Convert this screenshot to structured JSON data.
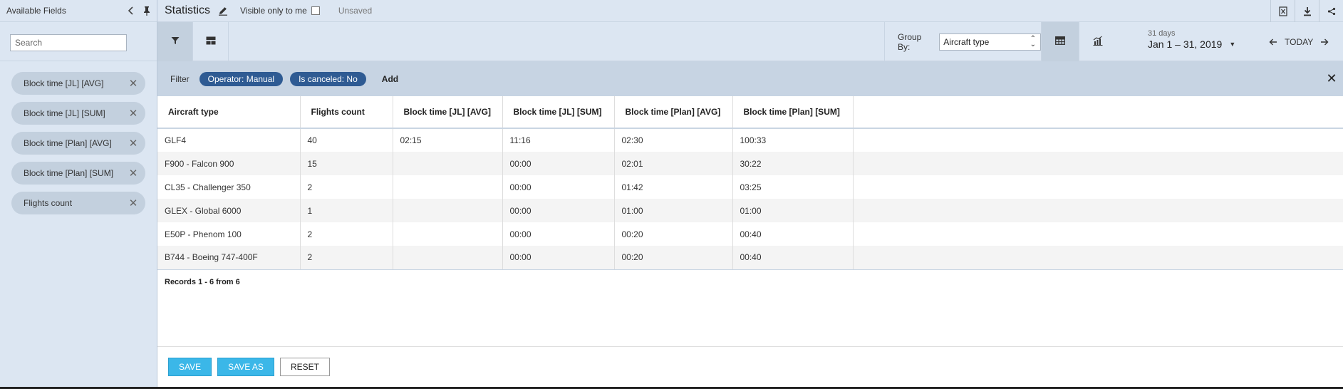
{
  "sidebar": {
    "title": "Available Fields",
    "search_placeholder": "Search",
    "chips": [
      {
        "label": "Block time [JL] [AVG]"
      },
      {
        "label": "Block time [JL] [SUM]"
      },
      {
        "label": "Block time [Plan] [AVG]"
      },
      {
        "label": "Block time [Plan] [SUM]"
      },
      {
        "label": "Flights count"
      }
    ]
  },
  "topbar": {
    "title": "Statistics",
    "visible_label": "Visible only to me",
    "status": "Unsaved"
  },
  "toolbar": {
    "groupby_label": "Group By:",
    "groupby_value": "Aircraft type",
    "range_days": "31 days",
    "range_dates": "Jan 1 – 31, 2019",
    "today_label": "TODAY"
  },
  "filter": {
    "label": "Filter",
    "pills": [
      "Operator: Manual",
      "Is canceled: No"
    ],
    "add_label": "Add"
  },
  "table": {
    "columns": [
      "Aircraft type",
      "Flights count",
      "Block time [JL] [AVG]",
      "Block time [JL] [SUM]",
      "Block time [Plan] [AVG]",
      "Block time [Plan] [SUM]"
    ],
    "rows": [
      [
        "GLF4",
        "40",
        "02:15",
        "11:16",
        "02:30",
        "100:33"
      ],
      [
        "F900 - Falcon 900",
        "15",
        "",
        "00:00",
        "02:01",
        "30:22"
      ],
      [
        "CL35 - Challenger 350",
        "2",
        "",
        "00:00",
        "01:42",
        "03:25"
      ],
      [
        "GLEX - Global 6000",
        "1",
        "",
        "00:00",
        "01:00",
        "01:00"
      ],
      [
        "E50P - Phenom 100",
        "2",
        "",
        "00:00",
        "00:20",
        "00:40"
      ],
      [
        "B744 - Boeing 747-400F",
        "2",
        "",
        "00:00",
        "00:20",
        "00:40"
      ]
    ],
    "records_text": "Records 1 - 6 from 6"
  },
  "footer": {
    "save_label": "SAVE",
    "save_as_label": "SAVE AS",
    "reset_label": "RESET"
  },
  "colors": {
    "panel_bg": "#dce6f2",
    "filter_bg": "#c7d4e3",
    "pill_bg": "#2f5b93",
    "primary_button": "#3bb7e8"
  }
}
